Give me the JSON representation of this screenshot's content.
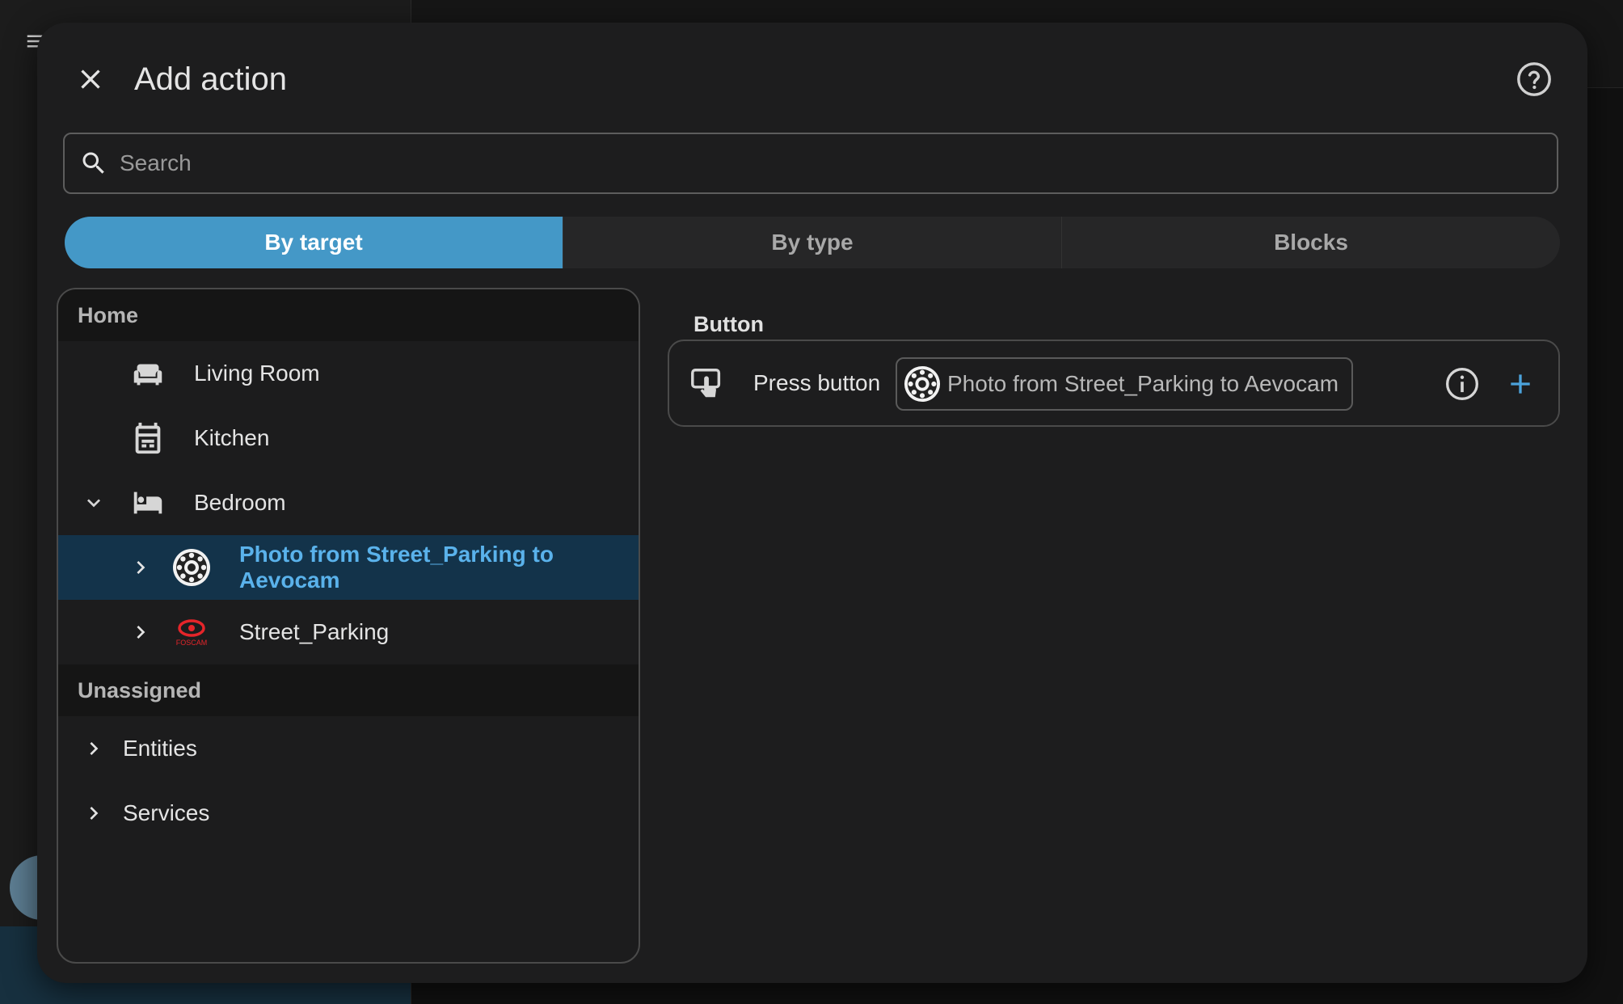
{
  "dialog": {
    "title": "Add action",
    "search": {
      "placeholder": "Search",
      "value": ""
    },
    "tabs": [
      {
        "label": "By target",
        "active": true
      },
      {
        "label": "By type",
        "active": false
      },
      {
        "label": "Blocks",
        "active": false
      }
    ]
  },
  "tree": {
    "sections": [
      {
        "label": "Home"
      },
      {
        "label": "Unassigned"
      }
    ],
    "home_items": [
      {
        "label": "Living Room",
        "icon": "sofa-icon"
      },
      {
        "label": "Kitchen",
        "icon": "stove-icon"
      },
      {
        "label": "Bedroom",
        "icon": "bed-icon",
        "expanded": true
      }
    ],
    "bedroom_devices": [
      {
        "label": "Photo from Street_Parking to Aevocam",
        "icon": "aperture-icon",
        "selected": true
      },
      {
        "label": "Street_Parking",
        "icon": "foscam-logo",
        "selected": false
      }
    ],
    "foscam_logo_text": "FOSCAM",
    "unassigned_items": [
      {
        "label": "Entities"
      },
      {
        "label": "Services"
      }
    ]
  },
  "results": {
    "group_title": "Button",
    "actions": [
      {
        "label": "Press button",
        "icon": "gesture-tap-button-icon",
        "target_chip": "Photo from Street_Parking to Aevocam"
      }
    ]
  },
  "colors": {
    "accent": "#4498c7",
    "selected_text": "#5ab2eb",
    "selected_row": "#13334a",
    "dialog_bg": "#1d1d1e"
  }
}
